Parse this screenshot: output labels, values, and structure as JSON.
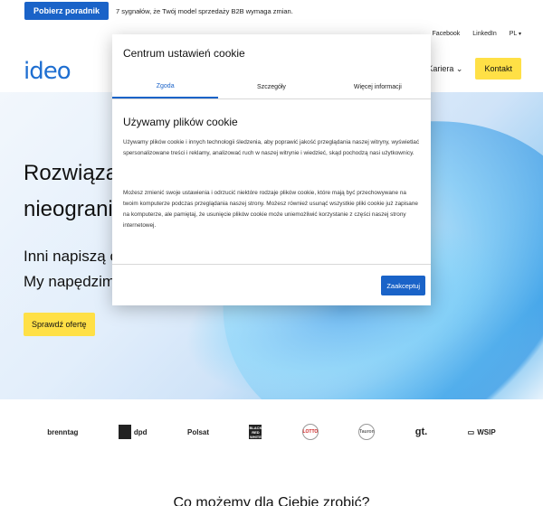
{
  "topbar": {
    "guide_button": "Pobierz poradnik",
    "message": "7 sygnałów, że Twój model sprzedaży B2B wymaga zmian."
  },
  "header": {
    "logo": "ideo",
    "toplinks": [
      "Facebook",
      "LinkedIn"
    ],
    "lang": "PL",
    "kariera": "Kariera",
    "kontakt": "Kontakt"
  },
  "hero": {
    "line1": "Rozwiązania",
    "line2": "nieograniczone",
    "sub1": "Inni napiszą oprogramowanie.",
    "sub2": "My napędzimy biznes.",
    "cta": "Sprawdź ofertę"
  },
  "logos": [
    "brenntag",
    "dpd",
    "Polsat",
    "BLACK RED WHITE",
    "LOTTO",
    "Tauron",
    "gt.",
    "WSIP"
  ],
  "section_title": "Co możemy dla Ciebie zrobić?",
  "modal": {
    "title": "Centrum ustawień cookie",
    "tabs": [
      "Zgoda",
      "Szczegóły",
      "Więcej informacji"
    ],
    "heading": "Używamy plików cookie",
    "para1": "Używamy plików cookie i innych technologii śledzenia, aby poprawić jakość przeglądania naszej witryny, wyświetlać spersonalizowane treści i reklamy, analizować ruch w naszej witrynie i wiedzieć, skąd pochodzą nasi użytkownicy.",
    "para2": "Możesz zmienić swoje ustawienia i odrzucić niektóre rodzaje plików cookie, które mają być przechowywane na twoim komputerze podczas przeglądania naszej strony. Możesz również usunąć wszystkie pliki cookie już zapisane na komputerze, ale pamiętaj, że usunięcie plików cookie może uniemożliwić korzystanie z części naszej strony internetowej.",
    "accept": "Zaakceptuj"
  },
  "colors": {
    "accent": "#1a63c8",
    "cta": "#ffe046"
  }
}
